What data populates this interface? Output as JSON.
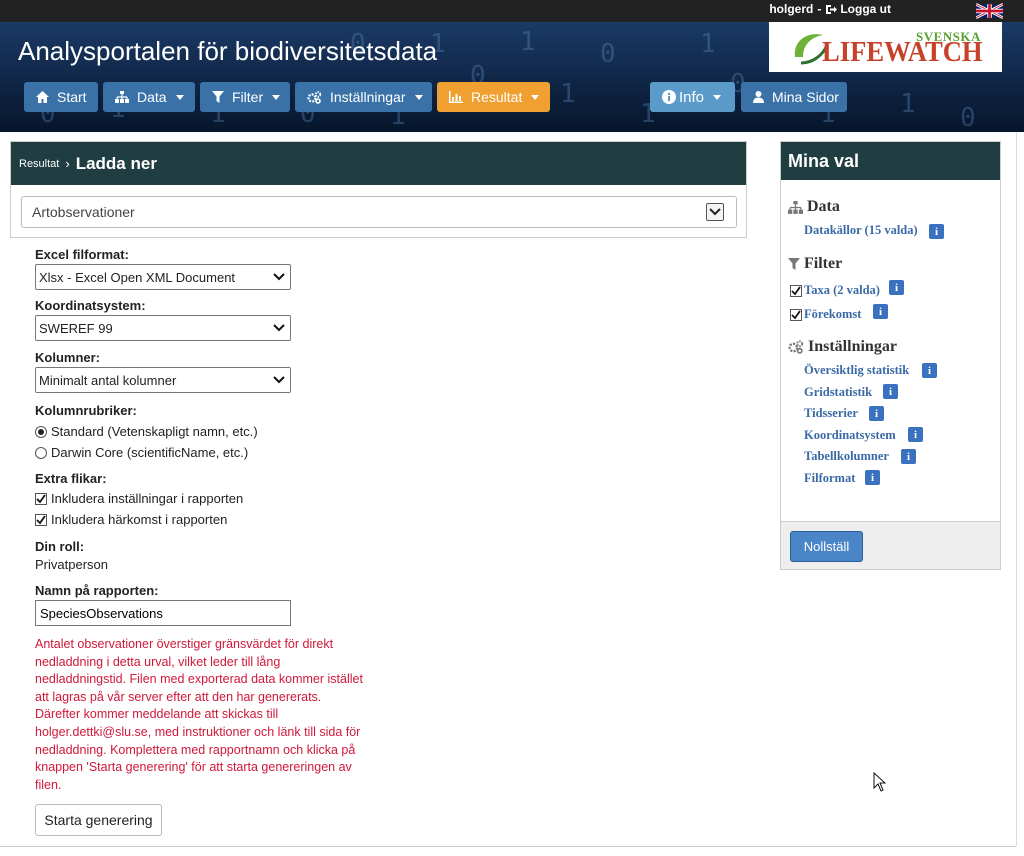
{
  "topbar": {
    "username": "holgerd",
    "separator": "-",
    "logout_label": "Logga ut"
  },
  "banner": {
    "site_title": "Analysportalen för biodiversitetsdata",
    "logo": {
      "line1": "SVENSKA",
      "line2": "LIFEWATCH"
    }
  },
  "nav": {
    "start": "Start",
    "data": "Data",
    "filter": "Filter",
    "settings": "Inställningar",
    "results": "Resultat",
    "info": "Info",
    "my_pages": "Mina Sidor"
  },
  "breadcrumb": {
    "parent": "Resultat",
    "separator": "›",
    "current": "Ladda ner"
  },
  "category_select": {
    "value": "Artobservationer"
  },
  "form": {
    "excel_format": {
      "label": "Excel filformat:",
      "value": "Xlsx - Excel Open XML Document"
    },
    "coordinate_system": {
      "label": "Koordinatsystem:",
      "value": "SWEREF 99"
    },
    "columns": {
      "label": "Kolumner:",
      "value": "Minimalt antal kolumner"
    },
    "column_headers": {
      "label": "Kolumnrubriker:",
      "options": [
        "Standard (Vetenskapligt namn, etc.)",
        "Darwin Core (scientificName, etc.)"
      ],
      "selected_index": 0
    },
    "extra_tabs": {
      "label": "Extra flikar:",
      "options": [
        "Inkludera inställningar i rapporten",
        "Inkludera härkomst i rapporten"
      ]
    },
    "role": {
      "label": "Din roll:",
      "value": "Privatperson"
    },
    "report_name": {
      "label": "Namn på rapporten:",
      "value": "SpeciesObservations"
    },
    "warning": "Antalet observationer överstiger gränsvärdet för direkt nedladdning i detta urval, vilket leder till lång nedladdningstid. Filen med exporterad data kommer istället att lagras på vår server efter att den har genererats. Därefter kommer meddelande att skickas till holger.dettki@slu.se, med instruktioner och länk till sida för nedladdning. Komplettera med rapportnamn och klicka på knappen 'Starta generering' för att starta genereringen av filen.",
    "generate_button": "Starta generering"
  },
  "my_choices": {
    "title": "Mina val",
    "data_section": "Data",
    "data_sources": "Datakällor (15 valda)",
    "filter_section": "Filter",
    "taxa": "Taxa (2 valda)",
    "occurrence": "Förekomst",
    "settings_section": "Inställningar",
    "settings_items": [
      "Översiktlig statistik",
      "Gridstatistik",
      "Tidsserier",
      "Koordinatsystem",
      "Tabellkolumner",
      "Filformat"
    ],
    "info_glyph": "i",
    "reset_button": "Nollställ"
  },
  "colors": {
    "header_dark": "#203d42",
    "nav_blue": "#3a72a8",
    "nav_orange": "#f0a030",
    "warning_red": "#d0183a",
    "link_blue": "#3a6aa6"
  }
}
